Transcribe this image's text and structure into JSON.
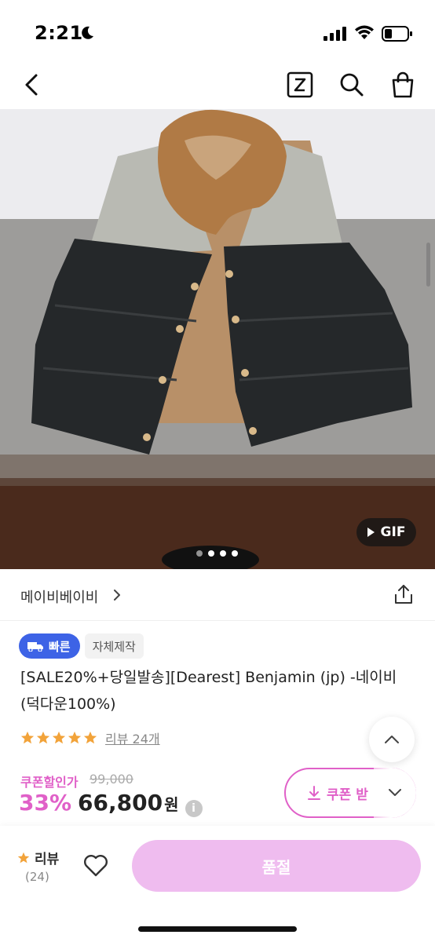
{
  "status_bar": {
    "time": "2:21"
  },
  "hero": {
    "gif_label": "GIF",
    "dots_count": 4,
    "active_dot": 1
  },
  "brand": {
    "name": "메이비베이비"
  },
  "badges": {
    "fast": "빠른",
    "own": "자체제작"
  },
  "product": {
    "title": "[SALE20%+당일발송][Dearest] Benjamin (jp) -네이비 (덕다운100%)",
    "rating_stars": 5,
    "review_link": "리뷰 24개"
  },
  "price": {
    "coupon_label": "쿠폰할인가",
    "original": "99,000",
    "discount": "33%",
    "final": "66,800",
    "currency": "원",
    "info": "i"
  },
  "coupon_button": {
    "label": "쿠폰 받"
  },
  "bottom": {
    "review_label": "리뷰",
    "review_count": "(24)",
    "soldout_label": "품절"
  },
  "colors": {
    "accent": "#e060c8",
    "fast_badge": "#3d63e6",
    "soldout": "#efbcef",
    "star": "#f2a33a"
  }
}
